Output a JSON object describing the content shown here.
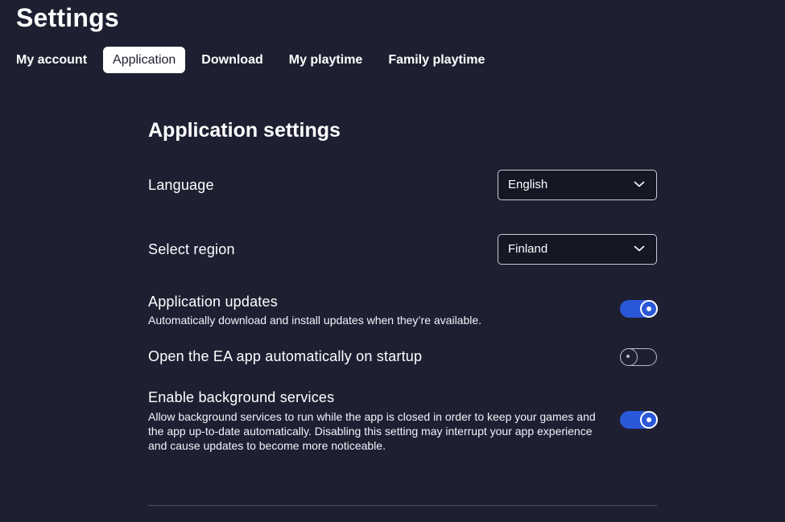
{
  "header": {
    "title": "Settings"
  },
  "tabs": [
    {
      "label": "My account",
      "active": false
    },
    {
      "label": "Application",
      "active": true
    },
    {
      "label": "Download",
      "active": false
    },
    {
      "label": "My playtime",
      "active": false
    },
    {
      "label": "Family playtime",
      "active": false
    }
  ],
  "section": {
    "title": "Application settings"
  },
  "language": {
    "label": "Language",
    "value": "English",
    "icon": "chevron-down-icon"
  },
  "region": {
    "label": "Select region",
    "value": "Finland",
    "icon": "chevron-down-icon"
  },
  "app_updates": {
    "label": "Application updates",
    "description": "Automatically download and install updates when they’re available.",
    "enabled": true
  },
  "startup": {
    "label": "Open the EA app automatically on startup",
    "enabled": false
  },
  "background_services": {
    "label": "Enable background services",
    "description": "Allow background services to run while the app is closed in order to keep your games and the app up-to-date automatically. Disabling this setting may interrupt your app experience and cause updates to become more noticeable.",
    "enabled": true
  },
  "colors": {
    "background": "#1e2032",
    "accent": "#2b57d9",
    "text": "#ffffff"
  }
}
